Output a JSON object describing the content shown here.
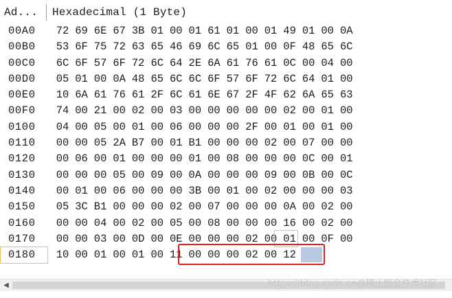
{
  "header": {
    "address_label": "Ad...",
    "hex_label": "Hexadecimal (1 Byte)"
  },
  "rows": [
    {
      "addr": "00A0",
      "bytes": [
        "72",
        "69",
        "6E",
        "67",
        "3B",
        "01",
        "00",
        "01",
        "61",
        "01",
        "00",
        "01",
        "49",
        "01",
        "00",
        "0A"
      ]
    },
    {
      "addr": "00B0",
      "bytes": [
        "53",
        "6F",
        "75",
        "72",
        "63",
        "65",
        "46",
        "69",
        "6C",
        "65",
        "01",
        "00",
        "0F",
        "48",
        "65",
        "6C"
      ]
    },
    {
      "addr": "00C0",
      "bytes": [
        "6C",
        "6F",
        "57",
        "6F",
        "72",
        "6C",
        "64",
        "2E",
        "6A",
        "61",
        "76",
        "61",
        "0C",
        "00",
        "04",
        "00"
      ]
    },
    {
      "addr": "00D0",
      "bytes": [
        "05",
        "01",
        "00",
        "0A",
        "48",
        "65",
        "6C",
        "6C",
        "6F",
        "57",
        "6F",
        "72",
        "6C",
        "64",
        "01",
        "00"
      ]
    },
    {
      "addr": "00E0",
      "bytes": [
        "10",
        "6A",
        "61",
        "76",
        "61",
        "2F",
        "6C",
        "61",
        "6E",
        "67",
        "2F",
        "4F",
        "62",
        "6A",
        "65",
        "63"
      ]
    },
    {
      "addr": "00F0",
      "bytes": [
        "74",
        "00",
        "21",
        "00",
        "02",
        "00",
        "03",
        "00",
        "00",
        "00",
        "00",
        "00",
        "02",
        "00",
        "01",
        "00"
      ]
    },
    {
      "addr": "0100",
      "bytes": [
        "04",
        "00",
        "05",
        "00",
        "01",
        "00",
        "06",
        "00",
        "00",
        "00",
        "2F",
        "00",
        "01",
        "00",
        "01",
        "00"
      ]
    },
    {
      "addr": "0110",
      "bytes": [
        "00",
        "00",
        "05",
        "2A",
        "B7",
        "00",
        "01",
        "B1",
        "00",
        "00",
        "00",
        "02",
        "00",
        "07",
        "00",
        "00"
      ]
    },
    {
      "addr": "0120",
      "bytes": [
        "00",
        "06",
        "00",
        "01",
        "00",
        "00",
        "00",
        "01",
        "00",
        "08",
        "00",
        "00",
        "00",
        "0C",
        "00",
        "01"
      ]
    },
    {
      "addr": "0130",
      "bytes": [
        "00",
        "00",
        "00",
        "05",
        "00",
        "09",
        "00",
        "0A",
        "00",
        "00",
        "00",
        "09",
        "00",
        "0B",
        "00",
        "0C"
      ]
    },
    {
      "addr": "0140",
      "bytes": [
        "00",
        "01",
        "00",
        "06",
        "00",
        "00",
        "00",
        "3B",
        "00",
        "01",
        "00",
        "02",
        "00",
        "00",
        "00",
        "03"
      ]
    },
    {
      "addr": "0150",
      "bytes": [
        "05",
        "3C",
        "B1",
        "00",
        "00",
        "00",
        "02",
        "00",
        "07",
        "00",
        "00",
        "00",
        "0A",
        "00",
        "02",
        "00"
      ]
    },
    {
      "addr": "0160",
      "bytes": [
        "00",
        "00",
        "04",
        "00",
        "02",
        "00",
        "05",
        "00",
        "08",
        "00",
        "00",
        "00",
        "16",
        "00",
        "02",
        "00"
      ]
    },
    {
      "addr": "0170",
      "bytes": [
        "00",
        "00",
        "03",
        "00",
        "0D",
        "00",
        "0E",
        "00",
        "00",
        "00",
        "02",
        "00",
        "01",
        "00",
        "0F",
        "00"
      ]
    },
    {
      "addr": "0180",
      "bytes": [
        "10",
        "00",
        "01",
        "00",
        "01",
        "00",
        "11",
        "00",
        "00",
        "00",
        "02",
        "00",
        "12"
      ]
    }
  ],
  "watermark": "https://blog.csdn.ne@稀土掘金技术社区",
  "colors": {
    "highlight_red": "#e21b1b",
    "cursor_gold": "#f2c053",
    "selection_blue": "#b9c9dd"
  },
  "icons": {
    "scroll_left": "left-arrow-icon"
  }
}
